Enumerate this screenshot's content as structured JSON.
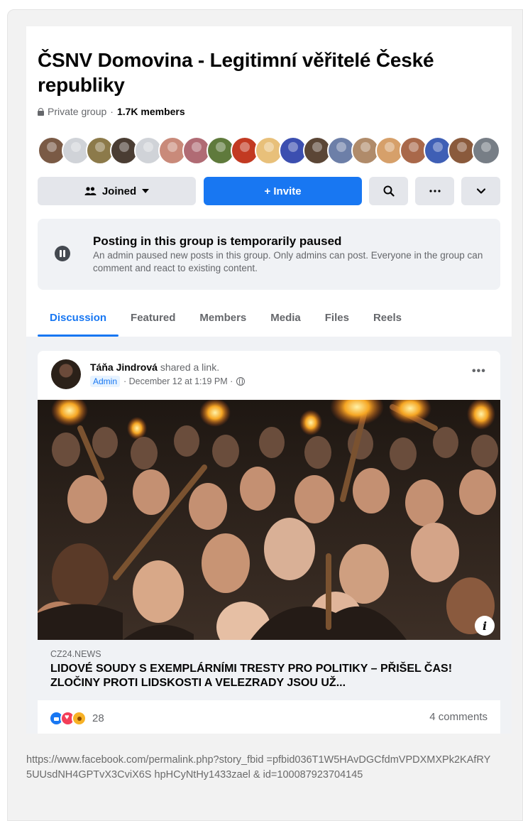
{
  "group": {
    "title": "ČSNV Domovina - Legitimní věřitelé České republiky",
    "privacy": "Private group",
    "separator": "·",
    "members": "1.7K members"
  },
  "member_avatars": [
    "#7a5a45",
    "#d0d3d8",
    "#8c7a4a",
    "#4a3d33",
    "#d0d3d8",
    "#c98a7a",
    "#b06b74",
    "#5f7a3c",
    "#c23a22",
    "#e8c07a",
    "#3c4fb0",
    "#5b4636",
    "#6d7fa8",
    "#b08b6a",
    "#d6a06a",
    "#a9684a",
    "#3f5fb5",
    "#8a5a3c",
    "#777e86"
  ],
  "actions": {
    "joined_label": "Joined",
    "invite_label": "+ Invite"
  },
  "notice": {
    "title": "Posting in this group is temporarily paused",
    "body": "An admin paused new posts in this group. Only admins can post. Everyone in the group can comment and react to existing content."
  },
  "tabs": [
    "Discussion",
    "Featured",
    "Members",
    "Media",
    "Files",
    "Reels"
  ],
  "active_tab": "Discussion",
  "post": {
    "author": "Táňa Jindrová",
    "action": "shared a link.",
    "badge": "Admin",
    "date": "December 12 at 1:19 PM",
    "link_domain": "CZ24.NEWS",
    "link_title": "LIDOVÉ SOUDY S EXEMPLÁRNÍMI TRESTY PRO POLITIKY – PŘIŠEL ČAS! ZLOČINY PROTI LIDSKOSTI A VELEZRADY JSOU UŽ...",
    "reaction_count": "28",
    "comments": "4 comments"
  },
  "footer_url": "https://www.facebook.com/permalink.php?story_fbid =pfbid036T1W5HAvDGCfdmVPDXMXPk2KAfRY5UUsdNH4GPTvX3CviX6S hpHCyNtHy1433zael & id=100087923704145",
  "colors": {
    "brand_blue": "#1877f2",
    "secondary_text": "#65676b",
    "page_bg": "#f0f2f5"
  }
}
